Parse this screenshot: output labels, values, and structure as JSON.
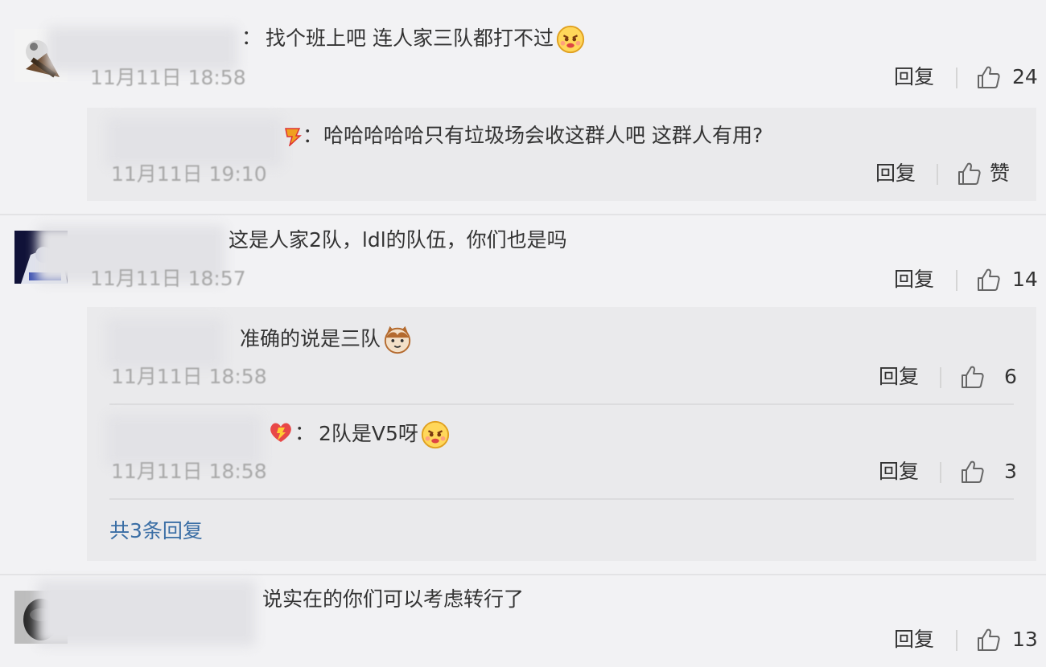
{
  "comments": [
    {
      "text": "找个班上吧 连人家三队都打不过",
      "time": "11月11日 18:58",
      "reply_label": "回复",
      "likes": "24",
      "emoji": "angry-face-emoji"
    },
    {
      "text": "这是人家2队，ldl的队伍，你们也是吗",
      "time": "11月11日 18:57",
      "reply_label": "回复",
      "likes": "14"
    },
    {
      "text": "说实在的你们可以考虑转行了",
      "reply_label": "回复",
      "likes": "13"
    }
  ],
  "replies": [
    {
      "text": "哈哈哈哈哈只有垃圾场会收这群人吧 这群人有用?",
      "time": "11月11日 19:10",
      "reply_label": "回复",
      "like_label": "赞"
    },
    {
      "text": "准确的说是三队",
      "time": "11月11日 18:58",
      "reply_label": "回复",
      "likes": "6",
      "emoji": "cat-face-emoji"
    },
    {
      "text": "2队是V5呀",
      "time": "11月11日 18:58",
      "reply_label": "回复",
      "likes": "3",
      "emoji": "angry-face-emoji"
    }
  ],
  "more_replies_label": "共3条回复",
  "icons": {
    "like": "thumbs-up-icon",
    "badge": "vip-badge-icon"
  },
  "colors": {
    "background": "#f2f2f4",
    "sub_panel": "#eaeaec",
    "link": "#3a6ea5",
    "time": "#a8a8a8"
  }
}
